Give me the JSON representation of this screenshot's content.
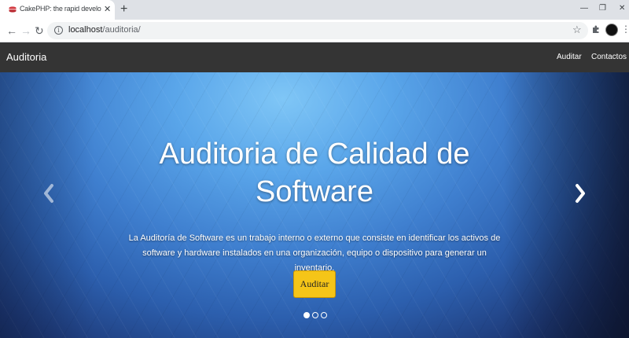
{
  "browser": {
    "tab": {
      "title": "CakePHP: the rapid development",
      "close": "✕"
    },
    "new_tab": "+",
    "window_controls": {
      "minimize": "—",
      "restore": "❐",
      "close": "✕"
    },
    "nav": {
      "back": "←",
      "forward": "→",
      "reload": "↻"
    },
    "address": {
      "host": "localhost",
      "path": "/auditoria/"
    },
    "icons": [
      "info-icon",
      "star-icon",
      "extensions-icon",
      "profile-avatar",
      "menu-icon"
    ]
  },
  "navbar": {
    "brand": "Auditoria",
    "links": [
      "Auditar",
      "Contactos"
    ]
  },
  "hero": {
    "title": "Auditoria de Calidad de Software",
    "description": "La Auditoría de Software es un trabajo interno o externo que consiste en identificar los activos de software y hardware instalados en una organización, equipo o dispositivo para generar un inventario.",
    "button_label": "Auditar",
    "slides_total": 3,
    "slide_active": 1,
    "button_color": "#f5c518"
  }
}
